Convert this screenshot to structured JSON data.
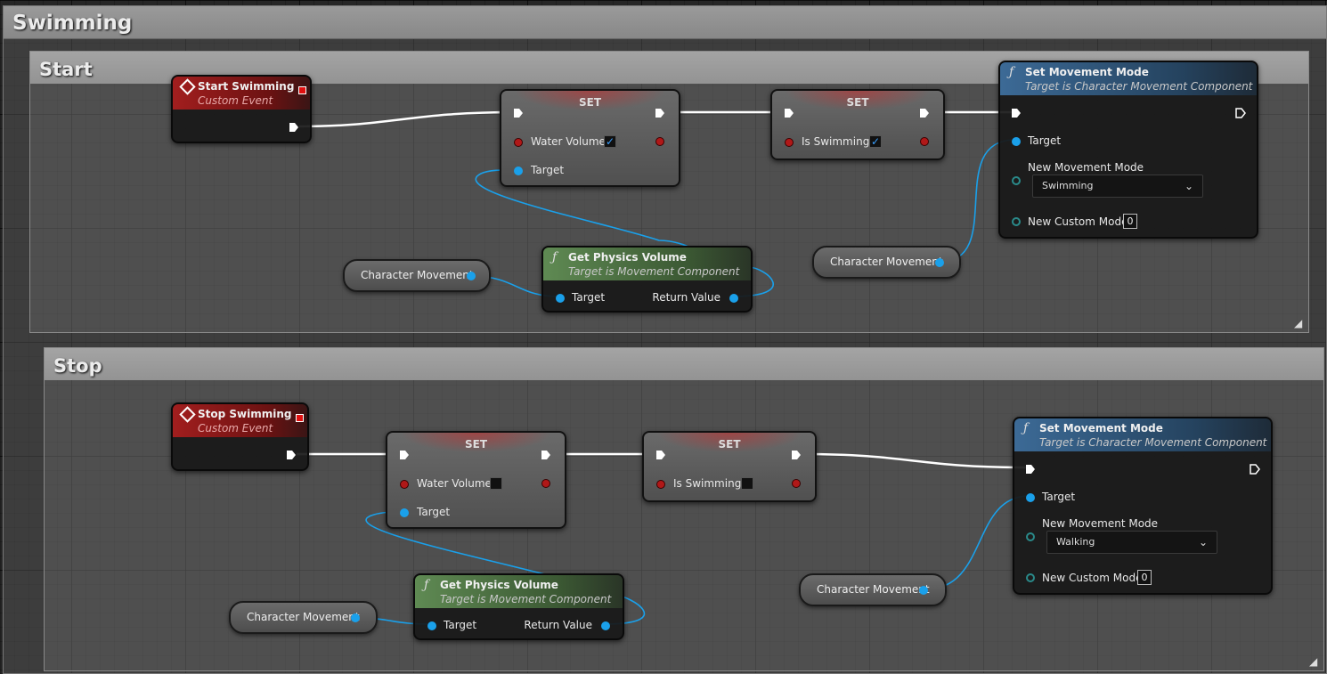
{
  "comments": {
    "outer": "Swimming",
    "start": "Start",
    "stop": "Stop"
  },
  "start": {
    "event": {
      "title": "Start Swimming",
      "subtitle": "Custom Event"
    },
    "set1": {
      "header": "SET",
      "var": "Water Volume",
      "checked": true,
      "target": "Target"
    },
    "set2": {
      "header": "SET",
      "var": "Is Swimming",
      "checked": true
    },
    "set_mode": {
      "title": "Set Movement Mode",
      "subtitle": "Target is Character Movement Component",
      "target": "Target",
      "mode_label": "New Movement Mode",
      "mode_value": "Swimming",
      "custom_label": "New Custom Mode",
      "custom_value": "0"
    },
    "phys": {
      "title": "Get Physics Volume",
      "subtitle": "Target is Movement Component",
      "target": "Target",
      "ret": "Return Value"
    },
    "cm_left": "Character Movement",
    "cm_right": "Character Movement"
  },
  "stop": {
    "event": {
      "title": "Stop Swimming",
      "subtitle": "Custom Event"
    },
    "set1": {
      "header": "SET",
      "var": "Water Volume",
      "checked": false,
      "target": "Target"
    },
    "set2": {
      "header": "SET",
      "var": "Is Swimming",
      "checked": false
    },
    "set_mode": {
      "title": "Set Movement Mode",
      "subtitle": "Target is Character Movement Component",
      "target": "Target",
      "mode_label": "New Movement Mode",
      "mode_value": "Walking",
      "custom_label": "New Custom Mode",
      "custom_value": "0"
    },
    "phys": {
      "title": "Get Physics Volume",
      "subtitle": "Target is Movement Component",
      "target": "Target",
      "ret": "Return Value"
    },
    "cm_left": "Character Movement",
    "cm_right": "Character Movement"
  },
  "icons": {
    "event": "diamond-event-icon",
    "function": "function-f-icon",
    "exec": "exec-arrow-icon",
    "check": "✓",
    "chevron": "chevron-down-icon",
    "resize": "resize-grip-icon"
  },
  "colors": {
    "object_pin": "#1aa0ea",
    "bool_pin": "#b01818",
    "event_header": "#a21e1e",
    "func_header": "#3c6a96",
    "pure_header": "#5f8a53",
    "exec_wire": "#ffffff"
  }
}
